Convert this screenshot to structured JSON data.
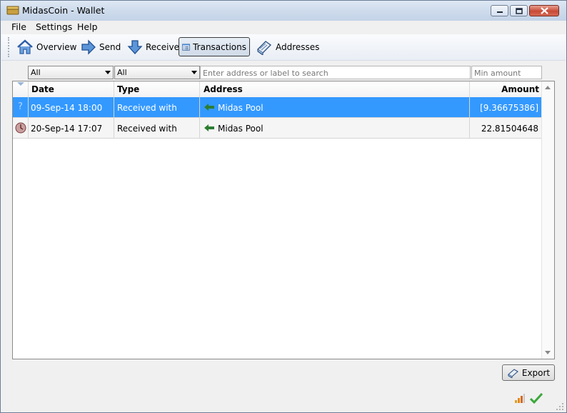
{
  "window": {
    "title": "MidasCoin - Wallet"
  },
  "menu": {
    "file": "File",
    "settings": "Settings",
    "help": "Help"
  },
  "toolbar": {
    "overview": "Overview",
    "send": "Send",
    "receive": "Receive",
    "transactions": "Transactions",
    "addresses": "Addresses"
  },
  "filters": {
    "date_filter": "All",
    "type_filter": "All",
    "search_placeholder": "Enter address or label to search",
    "amount_placeholder": "Min amount"
  },
  "table": {
    "headers": {
      "date": "Date",
      "type": "Type",
      "address": "Address",
      "amount": "Amount"
    },
    "rows": [
      {
        "status_icon": "question-mark-icon",
        "date": "09-Sep-14 18:00",
        "type": "Received with",
        "address": "Midas Pool",
        "amount": "[9.36675386]"
      },
      {
        "status_icon": "clock-icon",
        "date": "20-Sep-14 17:07",
        "type": "Received with",
        "address": "Midas Pool",
        "amount": "22.81504648"
      }
    ]
  },
  "actions": {
    "export": "Export"
  },
  "colors": {
    "selection": "#3399ff",
    "received_arrow": "#2e7d32"
  }
}
